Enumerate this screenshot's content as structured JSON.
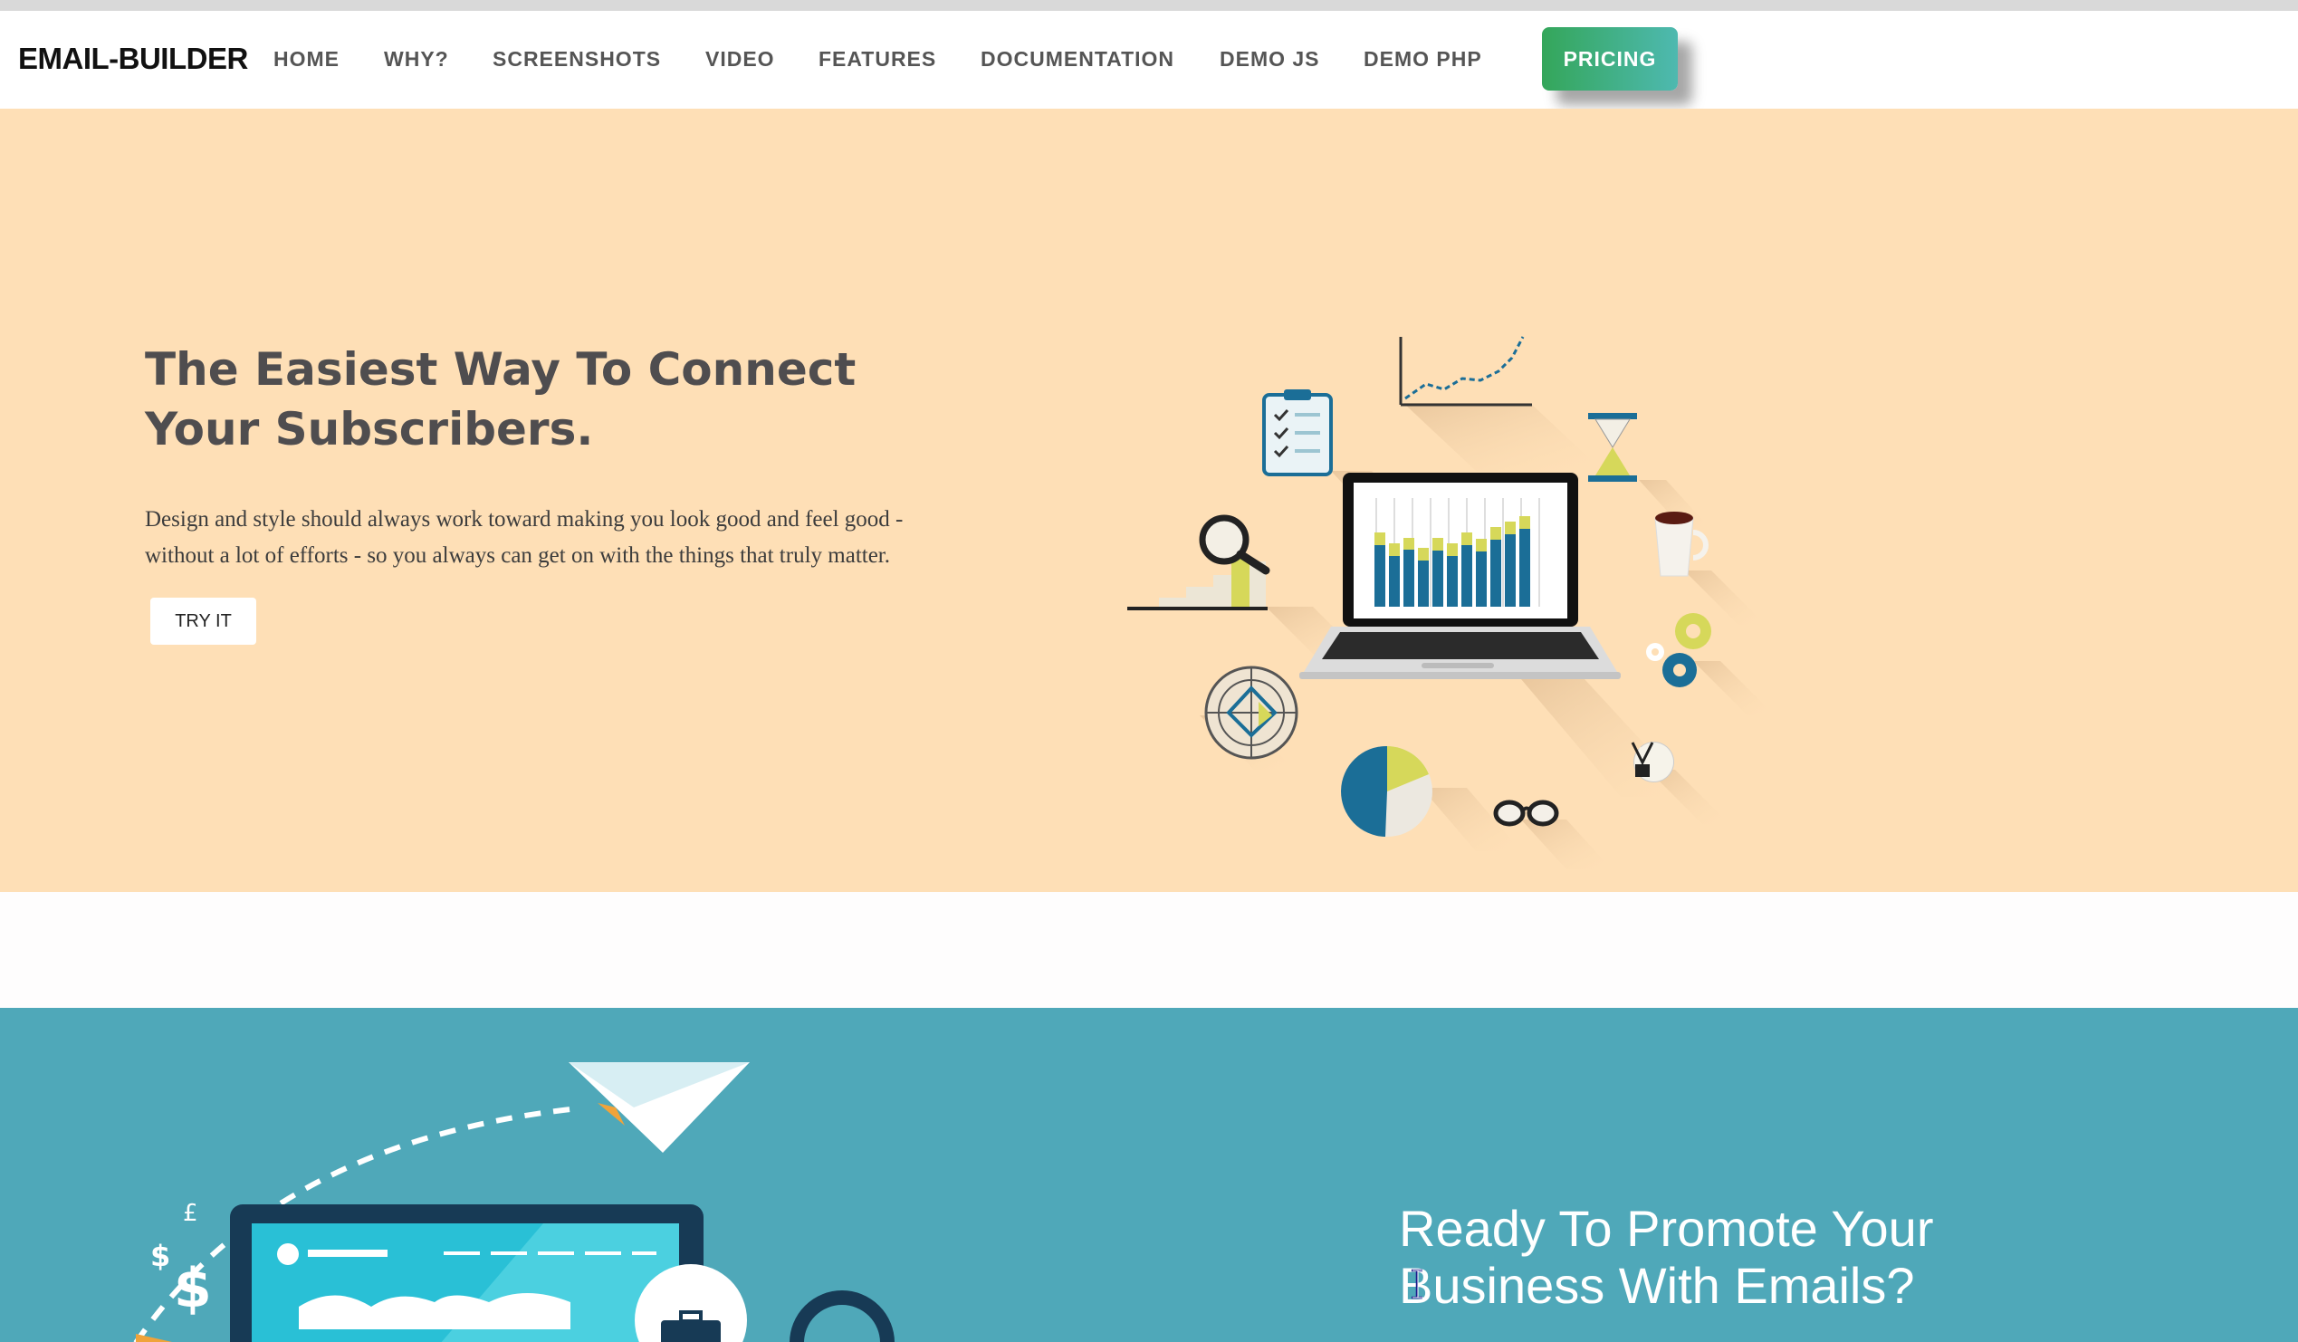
{
  "header": {
    "logo": "EMAIL-BUILDER",
    "nav": [
      "HOME",
      "WHY?",
      "SCREENSHOTS",
      "VIDEO",
      "FEATURES",
      "DOCUMENTATION",
      "DEMO JS",
      "DEMO PHP"
    ],
    "pricing_label": "PRICING"
  },
  "hero": {
    "title": "The Easiest Way To Connect Your Subscribers.",
    "text": "Design and style should always work toward making you look good and feel good - without a lot of efforts - so you always can get on with the things that truly matter.",
    "button_label": "TRY IT"
  },
  "promo": {
    "title": "Ready To Promote Your Business With Emails?",
    "currency_symbols": [
      "£",
      "$",
      "$"
    ]
  },
  "colors": {
    "hero_bg": "#fedfb6",
    "promo_bg": "#4fa8b9",
    "pricing_gradient": [
      "#34a65a",
      "#4eb9b0"
    ],
    "accent_blue": "#1b6e97",
    "accent_yellow": "#d6d85a"
  }
}
